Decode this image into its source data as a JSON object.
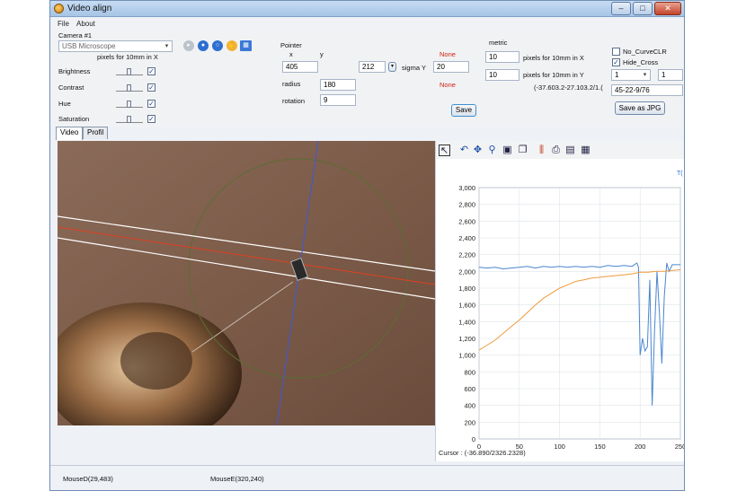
{
  "window": {
    "title": "Video align"
  },
  "window_controls": {
    "minimize": "–",
    "maximize": "□",
    "close": "✕"
  },
  "menu": {
    "items": [
      "File",
      "About"
    ]
  },
  "camera": {
    "label": "Camera #1",
    "device": "USB Microscope",
    "pixels_label": "pixels for 10mm in X",
    "controls": [
      {
        "label": "Brightness",
        "checked": true
      },
      {
        "label": "Contrast",
        "checked": true
      },
      {
        "label": "Hue",
        "checked": true
      },
      {
        "label": "Saturation",
        "checked": true
      }
    ],
    "icons": [
      "play-icon",
      "record-icon",
      "settings-ring-icon",
      "hand-icon",
      "grid-icon"
    ]
  },
  "pointer": {
    "label": "Pointer",
    "x_label": "x",
    "y_label": "y",
    "x_value": "405",
    "y_value": "212",
    "sigma_label": "sigma Y",
    "sigma_value": "20",
    "radius_label": "radius",
    "radius_value": "180",
    "rotation_label": "rotation",
    "rotation_value": "9",
    "none1": "None",
    "none2": "None",
    "save_label": "Save"
  },
  "metric": {
    "label": "metric",
    "x_value": "10",
    "x_label": "pixels for 10mm in X",
    "y_value": "10",
    "y_label": "pixels for 10mm in Y",
    "coords": "(-37.603.2-27.103.2/1.("
  },
  "options": {
    "no_curve_label": "No_CurveCLR",
    "no_curve_checked": false,
    "hide_cross_label": "Hide_Cross",
    "hide_cross_checked": true,
    "combo1": "1",
    "combo2": "1",
    "info": "45-22-9/76",
    "save_jpg_label": "Save as JPG"
  },
  "tabs": [
    {
      "label": "Video",
      "active": true
    },
    {
      "label": "Profil",
      "active": false
    }
  ],
  "chart_toolbar": {
    "icons": [
      "pointer-icon",
      "undo-icon",
      "pan-icon",
      "zoom-icon",
      "save-image-icon",
      "copy-icon",
      "bars-icon",
      "print-icon",
      "export-icon",
      "disk-icon"
    ],
    "corner_text": "T("
  },
  "chart_data": {
    "type": "line",
    "xlim": [
      0,
      250
    ],
    "ylim": [
      0,
      3000
    ],
    "xticks": [
      0,
      50,
      100,
      150,
      200,
      250
    ],
    "yticks": [
      "0",
      "200",
      "400",
      "600",
      "800",
      "1,000",
      "1,200",
      "1,400",
      "1,600",
      "1,800",
      "2,000",
      "2,200",
      "2,400",
      "2,600",
      "2,800",
      "3,000"
    ],
    "series": [
      {
        "color": "#4a86cf",
        "x": [
          0,
          10,
          20,
          30,
          40,
          50,
          60,
          70,
          80,
          90,
          100,
          110,
          120,
          130,
          140,
          150,
          160,
          170,
          180,
          190,
          196,
          198,
          200,
          203,
          206,
          209,
          212,
          215,
          218,
          221,
          224,
          227,
          230,
          233,
          236,
          240,
          250
        ],
        "y": [
          2050,
          2040,
          2050,
          2030,
          2040,
          2050,
          2060,
          2040,
          2060,
          2050,
          2060,
          2050,
          2060,
          2050,
          2060,
          2050,
          2070,
          2060,
          2070,
          2060,
          2100,
          2050,
          1000,
          1200,
          1050,
          1100,
          1900,
          400,
          1300,
          2000,
          1500,
          900,
          1700,
          2100,
          2000,
          2080,
          2080
        ]
      },
      {
        "color": "#f09a3e",
        "x": [
          0,
          10,
          20,
          30,
          40,
          50,
          60,
          70,
          80,
          90,
          100,
          110,
          120,
          130,
          140,
          150,
          160,
          170,
          180,
          190,
          200,
          210,
          220,
          230,
          240,
          250
        ],
        "y": [
          1060,
          1120,
          1180,
          1260,
          1340,
          1420,
          1510,
          1600,
          1680,
          1740,
          1800,
          1840,
          1880,
          1900,
          1920,
          1930,
          1940,
          1950,
          1960,
          1970,
          1990,
          1990,
          2000,
          2000,
          2010,
          2020
        ]
      }
    ]
  },
  "chart": {
    "cursor_text": "Cursor : (-36.890/2326.2328)"
  },
  "status": {
    "mouse_d": "MouseD(29,483)",
    "mouse_e": "MouseE(320,240)"
  }
}
